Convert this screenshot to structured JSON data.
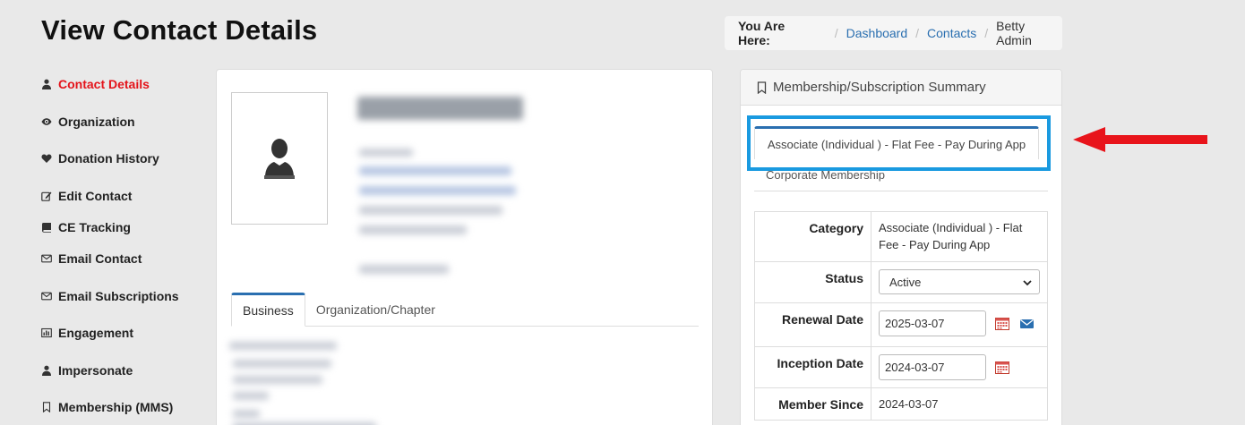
{
  "page": {
    "title": "View Contact Details"
  },
  "breadcrumb": {
    "lead": "You Are Here:",
    "items": [
      "Dashboard",
      "Contacts"
    ],
    "current": "Betty Admin"
  },
  "sidebar": {
    "items": [
      {
        "label": "Contact Details",
        "icon": "user-icon",
        "active": true
      },
      {
        "label": "Organization",
        "icon": "eye-icon"
      },
      {
        "label": "Donation History",
        "icon": "heart-icon"
      },
      {
        "label": "Edit Contact",
        "icon": "edit-icon"
      },
      {
        "label": "CE Tracking",
        "icon": "book-icon"
      },
      {
        "label": "Email Contact",
        "icon": "envelope-icon"
      },
      {
        "label": "Email Subscriptions",
        "icon": "envelope-icon"
      },
      {
        "label": "Engagement",
        "icon": "bar-chart-icon"
      },
      {
        "label": "Impersonate",
        "icon": "user-icon"
      },
      {
        "label": "Membership (MMS)",
        "icon": "bookmark-icon"
      }
    ]
  },
  "contact_tabs": [
    "Business",
    "Organization/Chapter"
  ],
  "membership": {
    "heading": "Membership/Subscription Summary",
    "tabs": [
      "Associate (Individual ) - Flat Fee - Pay During App",
      "Corporate Membership"
    ],
    "fields": {
      "category_label": "Category",
      "category_value": "Associate (Individual ) - Flat Fee - Pay During App",
      "status_label": "Status",
      "status_value": "Active",
      "renewal_label": "Renewal Date",
      "renewal_value": "2025-03-07",
      "inception_label": "Inception Date",
      "inception_value": "2024-03-07",
      "since_label": "Member Since",
      "since_value": "2024-03-07"
    }
  },
  "colors": {
    "accent": "#2a6fb0",
    "active_nav": "#e4141b",
    "highlight": "#1a9ae0",
    "arrow": "#e8141b"
  }
}
